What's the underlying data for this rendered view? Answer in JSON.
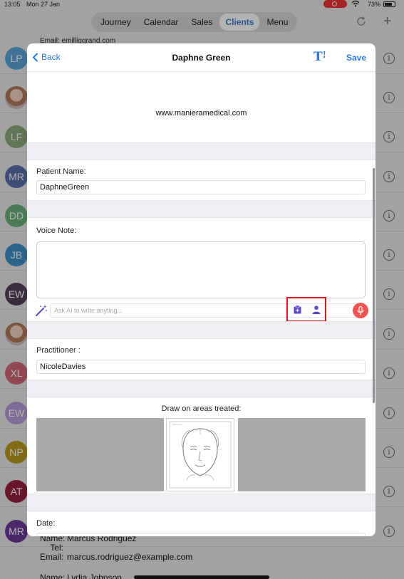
{
  "status_bar": {
    "time": "13:05",
    "date": "Mon 27 Jan",
    "battery": "73%"
  },
  "top_nav": {
    "tabs": [
      "Journey",
      "Calendar",
      "Sales",
      "Clients",
      "Menu"
    ],
    "active": "Clients"
  },
  "client_list": {
    "partial_email": "Email: emilliggrand.com",
    "rows": [
      {
        "initials": "LP",
        "color": "#5aa4d8"
      },
      {
        "initials": "",
        "color": "#d8b8a8",
        "photo": true
      },
      {
        "initials": "LF",
        "color": "#8aa878"
      },
      {
        "initials": "MR",
        "color": "#5a6fa8"
      },
      {
        "initials": "DD",
        "color": "#6bb07a"
      },
      {
        "initials": "JB",
        "color": "#3f8fc8"
      },
      {
        "initials": "EW",
        "color": "#55405c"
      },
      {
        "initials": "",
        "color": "#a07060",
        "photo": true
      },
      {
        "initials": "XL",
        "color": "#d06878"
      },
      {
        "initials": "EW",
        "color": "#b89cd8"
      },
      {
        "initials": "NP",
        "color": "#b89a20"
      },
      {
        "initials": "AT",
        "color": "#982040"
      },
      {
        "initials": "MR",
        "color": "#6a3a98"
      }
    ],
    "bottom_contact": {
      "name_label": "Name:",
      "name": "Marcus  Rodriguez",
      "tel_label": "Tel:",
      "tel": "",
      "email_label": "Email:",
      "email": "marcus.rodriguez@example.com"
    },
    "next_contact": {
      "name_label": "Name:",
      "name": "Lydia  Johnson"
    }
  },
  "modal": {
    "back_label": "Back",
    "title": "Daphne Green",
    "text_size_label": "T",
    "save_label": "Save",
    "website": "www.manieramedical.com",
    "patient_name_label": "Patient Name:",
    "patient_name_value": "DaphneGreen",
    "voice_note_label": "Voice Note:",
    "ai_placeholder": "Ask AI to write anyting...",
    "practitioner_label": "Practitioner :",
    "practitioner_value": "NicoleDavies",
    "draw_label": "Draw on areas treated:",
    "date_label": "Date:"
  },
  "colors": {
    "accent": "#2a7ae2",
    "icon_purple": "#5b47c9",
    "mic_red": "#ee5454",
    "highlight_red": "#e0141e"
  }
}
